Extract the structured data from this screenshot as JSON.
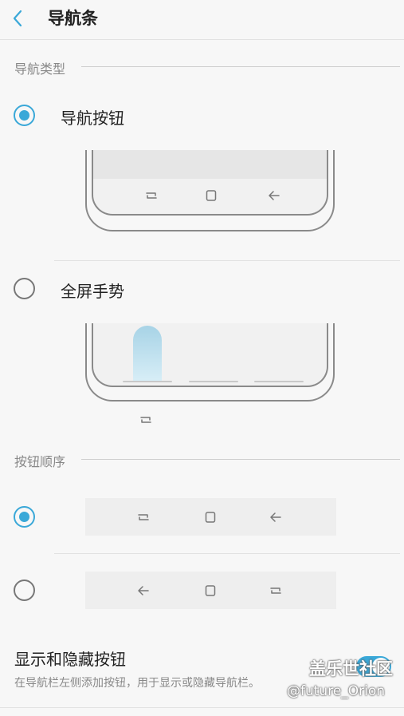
{
  "header": {
    "back_icon": "chevron-left-icon",
    "title": "导航条"
  },
  "nav_type": {
    "section_title": "导航类型",
    "options": [
      {
        "label": "导航按钮",
        "selected": true
      },
      {
        "label": "全屏手势",
        "selected": false
      }
    ]
  },
  "button_order": {
    "section_title": "按钮顺序",
    "options": [
      {
        "selected": true,
        "icons": [
          "recent-apps-icon",
          "home-icon",
          "back-icon"
        ]
      },
      {
        "selected": false,
        "icons": [
          "back-icon",
          "home-icon",
          "recent-apps-icon"
        ]
      }
    ]
  },
  "show_hide": {
    "title": "显示和隐藏按钮",
    "description": "在导航栏左侧添加按钮，用于显示或隐藏导航栏。",
    "enabled": true
  },
  "watermark": {
    "main": "盖乐世社区",
    "sub": "@future_Orion"
  },
  "colors": {
    "accent": "#3aa8d8",
    "background": "#f7f7f7"
  }
}
